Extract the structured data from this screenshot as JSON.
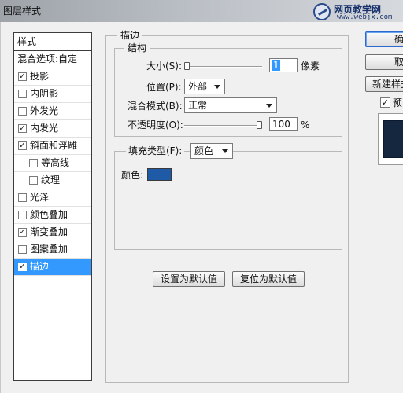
{
  "window": {
    "title": "图层样式",
    "watermark_text": "网页教学网",
    "watermark_url": "www.webjx.com"
  },
  "style_list": {
    "header": "样式",
    "blend_options": "混合选项:自定",
    "items": [
      {
        "label": "投影",
        "checked": true
      },
      {
        "label": "内阴影",
        "checked": false
      },
      {
        "label": "外发光",
        "checked": false
      },
      {
        "label": "内发光",
        "checked": true
      },
      {
        "label": "斜面和浮雕",
        "checked": true
      },
      {
        "label": "等高线",
        "checked": false,
        "sub": true
      },
      {
        "label": "纹理",
        "checked": false,
        "sub": true
      },
      {
        "label": "光泽",
        "checked": false
      },
      {
        "label": "颜色叠加",
        "checked": false
      },
      {
        "label": "渐变叠加",
        "checked": true
      },
      {
        "label": "图案叠加",
        "checked": false
      },
      {
        "label": "描边",
        "checked": true,
        "selected": true
      }
    ]
  },
  "stroke": {
    "section_title": "描边",
    "structure_title": "结构",
    "size_label": "大小(S):",
    "size_value": "1",
    "size_unit": "像素",
    "size_fraction": 0.0,
    "position_label": "位置(P):",
    "position_value": "外部",
    "blend_mode_label": "混合模式(B):",
    "blend_mode_value": "正常",
    "opacity_label": "不透明度(O):",
    "opacity_value": "100",
    "opacity_unit": "%",
    "opacity_fraction": 1.0,
    "fill_type_label": "填充类型(F):",
    "fill_type_value": "颜色",
    "color_label": "颜色:",
    "color_value": "#1f5aa6"
  },
  "buttons": {
    "set_default": "设置为默认值",
    "reset_default": "复位为默认值",
    "ok": "确",
    "cancel": "取",
    "new_style": "新建样式",
    "preview": "预"
  },
  "colors": {
    "selection": "#3399ff",
    "swatch": "#1f5aa6"
  }
}
